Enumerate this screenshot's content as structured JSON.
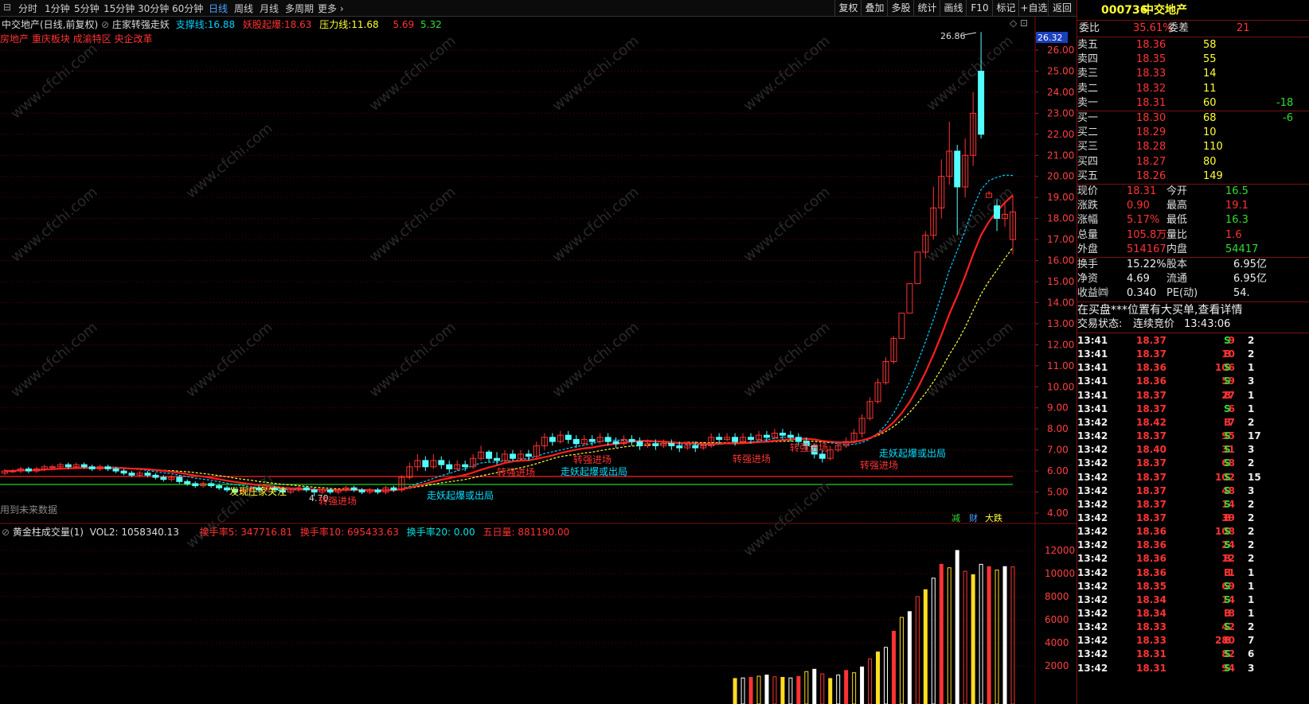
{
  "toolbar": {
    "periods": [
      "分时",
      "1分钟",
      "5分钟",
      "15分钟",
      "30分钟",
      "60分钟",
      "日线",
      "周线",
      "月线",
      "多周期",
      "更多"
    ],
    "active": "日线",
    "right": [
      "复权",
      "叠加",
      "多股",
      "统计",
      "画线",
      "F10",
      "标记",
      "+自选",
      "返回"
    ]
  },
  "legend": {
    "name": "中交地产(日线,前复权)",
    "indicator": "庄家转强走妖",
    "support_label": "支撑线:",
    "support_value": "16.88",
    "demon_label": "妖股起爆:",
    "demon_value": "18.63",
    "pressure_label": "压力线:",
    "pressure_value": "11.68",
    "v1": "5.69",
    "v2": "5.32",
    "tags": "房地产 重庆板块 成渝特区 央企改革",
    "future": "用到未来数据"
  },
  "price_axis": {
    "labels": [
      "26.00",
      "25.00",
      "24.00",
      "23.00",
      "22.00",
      "21.00",
      "20.00",
      "19.00",
      "18.00",
      "17.00",
      "16.00",
      "15.00",
      "14.00",
      "13.00",
      "12.00",
      "11.00",
      "10.00",
      "9.00",
      "8.00",
      "7.00",
      "6.00",
      "5.00",
      "4.00"
    ],
    "current": "26.32",
    "peak_label": "26.86",
    "low_label": "4.70"
  },
  "signals": [
    {
      "text": "发现庄家关注",
      "color": "#ffff33"
    },
    {
      "text": "转强进场",
      "color": "#ff3333"
    },
    {
      "text": "走妖起爆或出局",
      "color": "#00e0ff"
    },
    {
      "text": "转强进场",
      "color": "#ff3333"
    },
    {
      "text": "转强进场",
      "color": "#ff3333"
    },
    {
      "text": "走妖起爆或出局",
      "color": "#00e0ff"
    },
    {
      "text": "转强进场",
      "color": "#ff3333"
    },
    {
      "text": "转强进场",
      "color": "#ff3333"
    },
    {
      "text": "转强进场",
      "color": "#ff3333"
    },
    {
      "text": "走妖起爆或出局",
      "color": "#00e0ff"
    }
  ],
  "badges": [
    "减",
    "财",
    "大跌"
  ],
  "vol_legend": {
    "name": "黄金柱成交量(1)",
    "vol2": "VOL2: 1058340.13",
    "t5": "换手率5: 347716.81",
    "t10": "换手率10: 695433.63",
    "t20": "换手率20: 0.00",
    "w": "五日量: 881190.00"
  },
  "vol_axis": [
    "12000",
    "10000",
    "8000",
    "6000",
    "4000",
    "2000"
  ],
  "quote": {
    "code": "000736",
    "name": "中交地产",
    "ratio_label": "委比",
    "ratio": "35.61%",
    "diff_label": "委差",
    "diff": "21",
    "asks": [
      {
        "label": "卖五",
        "price": "18.36",
        "vol": "58",
        "chg": ""
      },
      {
        "label": "卖四",
        "price": "18.35",
        "vol": "55",
        "chg": ""
      },
      {
        "label": "卖三",
        "price": "18.33",
        "vol": "14",
        "chg": ""
      },
      {
        "label": "卖二",
        "price": "18.32",
        "vol": "11",
        "chg": ""
      },
      {
        "label": "卖一",
        "price": "18.31",
        "vol": "60",
        "chg": "-18"
      }
    ],
    "bids": [
      {
        "label": "买一",
        "price": "18.30",
        "vol": "68",
        "chg": "-6"
      },
      {
        "label": "买二",
        "price": "18.29",
        "vol": "10",
        "chg": ""
      },
      {
        "label": "买三",
        "price": "18.28",
        "vol": "110",
        "chg": ""
      },
      {
        "label": "买四",
        "price": "18.27",
        "vol": "80",
        "chg": ""
      },
      {
        "label": "买五",
        "price": "18.26",
        "vol": "149",
        "chg": ""
      }
    ],
    "stats": [
      {
        "l1": "现价",
        "v1": "18.31",
        "l2": "今开",
        "v2": "16.5"
      },
      {
        "l1": "涨跌",
        "v1": "0.90",
        "l2": "最高",
        "v2": "19.1"
      },
      {
        "l1": "涨幅",
        "v1": "5.17%",
        "l2": "最低",
        "v2": "16.3"
      },
      {
        "l1": "总量",
        "v1": "105.8万",
        "l2": "量比",
        "v2": "1.6"
      },
      {
        "l1": "外盘",
        "v1": "514167",
        "l2": "内盘",
        "v2": "54417"
      }
    ],
    "stats2": [
      {
        "l1": "换手",
        "v1": "15.22%",
        "l2": "股本",
        "v2": "6.95亿"
      },
      {
        "l1": "净资",
        "v1": "4.69",
        "l2": "流通",
        "v2": "6.95亿"
      },
      {
        "l1": "收益㈣",
        "v1": "0.340",
        "l2": "PE(动)",
        "v2": "54."
      }
    ],
    "notice": "在买盘***位置有大买单,查看详情",
    "status_label": "交易状态:",
    "status": "连续竞价",
    "time": "13:43:06"
  },
  "ticks": [
    {
      "t": "13:41",
      "p": "18.37",
      "v": "9",
      "s": "S",
      "x": "2"
    },
    {
      "t": "13:41",
      "p": "18.37",
      "v": "10",
      "s": "B",
      "x": "2"
    },
    {
      "t": "13:41",
      "p": "18.36",
      "v": "106",
      "s": "S",
      "x": "1"
    },
    {
      "t": "13:41",
      "p": "18.36",
      "v": "59",
      "s": "S",
      "x": "3"
    },
    {
      "t": "13:41",
      "p": "18.37",
      "v": "27",
      "s": "B",
      "x": "1"
    },
    {
      "t": "13:41",
      "p": "18.37",
      "v": "6",
      "s": "S",
      "x": "1"
    },
    {
      "t": "13:42",
      "p": "18.42",
      "v": "7",
      "s": "B",
      "x": "2"
    },
    {
      "t": "13:42",
      "p": "18.37",
      "v": "95",
      "s": "S",
      "x": "17"
    },
    {
      "t": "13:42",
      "p": "18.40",
      "v": "31",
      "s": "S",
      "x": "3"
    },
    {
      "t": "13:42",
      "p": "18.37",
      "v": "68",
      "s": "S",
      "x": "2"
    },
    {
      "t": "13:42",
      "p": "18.37",
      "v": "102",
      "s": "S",
      "x": "15"
    },
    {
      "t": "13:42",
      "p": "18.37",
      "v": "48",
      "s": "S",
      "x": "3"
    },
    {
      "t": "13:42",
      "p": "18.37",
      "v": "14",
      "s": "S",
      "x": "2"
    },
    {
      "t": "13:42",
      "p": "18.37",
      "v": "39",
      "s": "B",
      "x": "2"
    },
    {
      "t": "13:42",
      "p": "18.36",
      "v": "108",
      "s": "S",
      "x": "2"
    },
    {
      "t": "13:42",
      "p": "18.36",
      "v": "24",
      "s": "S",
      "x": "2"
    },
    {
      "t": "13:42",
      "p": "18.36",
      "v": "12",
      "s": "B",
      "x": "2"
    },
    {
      "t": "13:42",
      "p": "18.36",
      "v": "1",
      "s": "B",
      "x": "1"
    },
    {
      "t": "13:42",
      "p": "18.35",
      "v": "69",
      "s": "S",
      "x": "1"
    },
    {
      "t": "13:42",
      "p": "18.34",
      "v": "14",
      "s": "S",
      "x": "1"
    },
    {
      "t": "13:42",
      "p": "18.34",
      "v": "8",
      "s": "B",
      "x": "1"
    },
    {
      "t": "13:42",
      "p": "18.33",
      "v": "42",
      "s": "S",
      "x": "2"
    },
    {
      "t": "13:42",
      "p": "18.33",
      "v": "280",
      "s": "B",
      "x": "7"
    },
    {
      "t": "13:42",
      "p": "18.31",
      "v": "82",
      "s": "S",
      "x": "6"
    },
    {
      "t": "13:42",
      "p": "18.31",
      "v": "94",
      "s": "S",
      "x": "3"
    }
  ],
  "colors": {
    "up": "#ff3333",
    "down": "#54ffff",
    "grid": "#5a0000",
    "support": "#ff2020",
    "demon": "#00d0ff",
    "pressure": "#ffff40"
  },
  "chart_data": {
    "type": "candlestick",
    "ylim": [
      4,
      27
    ],
    "candles": [
      [
        5.9,
        6.0,
        6.1,
        5.8
      ],
      [
        6.0,
        6.0,
        6.1,
        5.9
      ],
      [
        6.0,
        6.1,
        6.2,
        5.9
      ],
      [
        6.1,
        6.0,
        6.2,
        5.9
      ],
      [
        6.0,
        6.1,
        6.2,
        5.9
      ],
      [
        6.1,
        6.2,
        6.3,
        6.0
      ],
      [
        6.2,
        6.2,
        6.3,
        6.1
      ],
      [
        6.2,
        6.3,
        6.4,
        6.1
      ],
      [
        6.3,
        6.2,
        6.4,
        6.1
      ],
      [
        6.2,
        6.3,
        6.4,
        6.1
      ],
      [
        6.3,
        6.2,
        6.4,
        6.1
      ],
      [
        6.2,
        6.1,
        6.3,
        6.0
      ],
      [
        6.1,
        6.2,
        6.3,
        6.0
      ],
      [
        6.2,
        6.1,
        6.3,
        6.0
      ],
      [
        6.1,
        6.0,
        6.2,
        5.9
      ],
      [
        6.0,
        5.9,
        6.1,
        5.8
      ],
      [
        5.9,
        5.8,
        6.0,
        5.7
      ],
      [
        5.8,
        5.9,
        6.0,
        5.7
      ],
      [
        5.9,
        5.8,
        6.0,
        5.7
      ],
      [
        5.8,
        5.7,
        5.9,
        5.6
      ],
      [
        5.7,
        5.6,
        5.8,
        5.5
      ],
      [
        5.6,
        5.7,
        5.8,
        5.5
      ],
      [
        5.7,
        5.5,
        5.8,
        5.4
      ],
      [
        5.5,
        5.4,
        5.6,
        5.3
      ],
      [
        5.4,
        5.3,
        5.5,
        5.2
      ],
      [
        5.3,
        5.4,
        5.5,
        5.2
      ],
      [
        5.4,
        5.3,
        5.5,
        5.2
      ],
      [
        5.3,
        5.2,
        5.4,
        5.1
      ],
      [
        5.2,
        5.1,
        5.3,
        5.0
      ],
      [
        5.1,
        5.0,
        5.2,
        4.9
      ],
      [
        5.0,
        5.1,
        5.2,
        4.9
      ],
      [
        5.1,
        5.2,
        5.3,
        5.0
      ],
      [
        5.2,
        5.1,
        5.3,
        5.0
      ],
      [
        5.1,
        5.2,
        5.3,
        5.0
      ],
      [
        5.2,
        5.1,
        5.3,
        5.0
      ],
      [
        5.1,
        5.0,
        5.2,
        4.9
      ],
      [
        5.0,
        5.1,
        5.2,
        4.9
      ],
      [
        5.1,
        5.2,
        5.3,
        5.0
      ],
      [
        5.2,
        5.1,
        5.3,
        5.0
      ],
      [
        5.1,
        5.0,
        5.2,
        4.8
      ],
      [
        5.0,
        5.1,
        5.2,
        4.9
      ],
      [
        5.1,
        5.0,
        5.2,
        4.9
      ],
      [
        5.0,
        5.1,
        5.2,
        4.9
      ],
      [
        5.1,
        5.2,
        5.3,
        5.0
      ],
      [
        5.2,
        5.1,
        5.3,
        5.0
      ],
      [
        5.1,
        5.0,
        5.2,
        4.9
      ],
      [
        5.0,
        5.1,
        5.2,
        4.9
      ],
      [
        5.1,
        5.0,
        5.2,
        4.9
      ],
      [
        5.0,
        5.2,
        5.3,
        4.9
      ],
      [
        5.2,
        5.1,
        5.3,
        5.0
      ],
      [
        5.1,
        5.7,
        5.8,
        5.0
      ],
      [
        5.7,
        6.2,
        6.4,
        5.6
      ],
      [
        6.2,
        6.5,
        6.8,
        6.0
      ],
      [
        6.5,
        6.2,
        6.7,
        6.0
      ],
      [
        6.2,
        6.5,
        6.8,
        6.1
      ],
      [
        6.5,
        6.3,
        6.7,
        6.1
      ],
      [
        6.3,
        6.1,
        6.5,
        5.9
      ],
      [
        6.1,
        6.3,
        6.5,
        6.0
      ],
      [
        6.3,
        6.2,
        6.5,
        6.0
      ],
      [
        6.2,
        6.6,
        6.8,
        6.1
      ],
      [
        6.6,
        6.9,
        7.2,
        6.5
      ],
      [
        6.9,
        6.6,
        7.0,
        6.4
      ],
      [
        6.6,
        6.5,
        6.9,
        6.3
      ],
      [
        6.5,
        6.8,
        7.0,
        6.4
      ],
      [
        6.8,
        6.6,
        7.0,
        6.5
      ],
      [
        6.6,
        6.8,
        7.0,
        6.5
      ],
      [
        6.8,
        6.7,
        7.0,
        6.5
      ],
      [
        6.7,
        7.2,
        7.4,
        6.6
      ],
      [
        7.2,
        7.6,
        7.8,
        7.0
      ],
      [
        7.6,
        7.4,
        7.8,
        7.2
      ],
      [
        7.4,
        7.7,
        7.9,
        7.3
      ],
      [
        7.7,
        7.5,
        7.9,
        7.3
      ],
      [
        7.5,
        7.3,
        7.7,
        7.1
      ],
      [
        7.3,
        7.5,
        7.7,
        7.2
      ],
      [
        7.5,
        7.4,
        7.7,
        7.2
      ],
      [
        7.4,
        7.6,
        7.8,
        7.3
      ],
      [
        7.6,
        7.4,
        7.8,
        7.2
      ],
      [
        7.4,
        7.3,
        7.6,
        7.1
      ],
      [
        7.3,
        7.5,
        7.7,
        7.2
      ],
      [
        7.5,
        7.4,
        7.7,
        7.2
      ],
      [
        7.4,
        7.2,
        7.6,
        7.0
      ],
      [
        7.2,
        7.3,
        7.5,
        7.1
      ],
      [
        7.3,
        7.2,
        7.5,
        7.0
      ],
      [
        7.2,
        7.3,
        7.5,
        7.1
      ],
      [
        7.3,
        7.2,
        7.5,
        7.0
      ],
      [
        7.2,
        7.1,
        7.4,
        6.9
      ],
      [
        7.1,
        7.2,
        7.4,
        7.0
      ],
      [
        7.2,
        7.1,
        7.4,
        6.9
      ],
      [
        7.1,
        7.2,
        7.4,
        7.0
      ],
      [
        7.2,
        7.6,
        7.8,
        7.1
      ],
      [
        7.6,
        7.5,
        7.8,
        7.3
      ],
      [
        7.5,
        7.6,
        7.8,
        7.4
      ],
      [
        7.6,
        7.4,
        7.8,
        7.2
      ],
      [
        7.4,
        7.6,
        7.8,
        7.3
      ],
      [
        7.6,
        7.5,
        7.8,
        7.3
      ],
      [
        7.5,
        7.7,
        7.9,
        7.4
      ],
      [
        7.7,
        7.6,
        7.9,
        7.4
      ],
      [
        7.6,
        7.8,
        8.0,
        7.5
      ],
      [
        7.8,
        7.7,
        8.0,
        7.5
      ],
      [
        7.7,
        7.6,
        7.9,
        7.4
      ],
      [
        7.6,
        7.4,
        7.8,
        7.2
      ],
      [
        7.4,
        7.2,
        7.6,
        7.0
      ],
      [
        7.2,
        6.8,
        7.3,
        6.6
      ],
      [
        6.8,
        6.6,
        7.0,
        6.4
      ],
      [
        6.6,
        7.0,
        7.2,
        6.5
      ],
      [
        7.0,
        7.2,
        7.4,
        6.9
      ],
      [
        7.2,
        7.4,
        7.6,
        7.1
      ],
      [
        7.4,
        7.8,
        8.0,
        7.3
      ],
      [
        7.8,
        8.5,
        8.7,
        7.6
      ],
      [
        8.5,
        9.3,
        9.5,
        8.4
      ],
      [
        9.3,
        10.2,
        10.4,
        9.2
      ],
      [
        10.2,
        11.2,
        11.4,
        10.1
      ],
      [
        11.2,
        12.3,
        12.4,
        11.1
      ],
      [
        12.3,
        13.5,
        13.5,
        13.5
      ],
      [
        13.5,
        14.9,
        14.9,
        14.9
      ],
      [
        14.9,
        16.4,
        16.4,
        16.4
      ],
      [
        16.4,
        17.2,
        17.4,
        16.1
      ],
      [
        17.2,
        18.5,
        19.5,
        17.0
      ],
      [
        18.5,
        20.0,
        20.8,
        18.0
      ],
      [
        20.0,
        21.2,
        22.6,
        19.6
      ],
      [
        21.2,
        19.5,
        21.5,
        17.2
      ],
      [
        19.5,
        21.0,
        21.8,
        19.0
      ],
      [
        21.0,
        23.0,
        24.0,
        20.5
      ],
      [
        25.0,
        22.0,
        26.86,
        21.8
      ],
      [
        19.0,
        19.2,
        19.3,
        19.1
      ],
      [
        18.6,
        18.0,
        18.9,
        17.4
      ],
      [
        18.0,
        18.2,
        18.8,
        17.6
      ],
      [
        17.0,
        18.31,
        19.1,
        16.3
      ]
    ],
    "volumes": [
      900,
      950,
      1000,
      1100,
      1200,
      1050,
      1000,
      950,
      1080,
      1500,
      1700,
      1300,
      900,
      1200,
      1600,
      1400,
      1900,
      2600,
      3200,
      3600,
      5000,
      6200,
      6700,
      8000,
      8600,
      9600,
      10800,
      10500,
      12500,
      10200,
      9900,
      10800,
      10600,
      10300,
      10600,
      10580
    ]
  }
}
